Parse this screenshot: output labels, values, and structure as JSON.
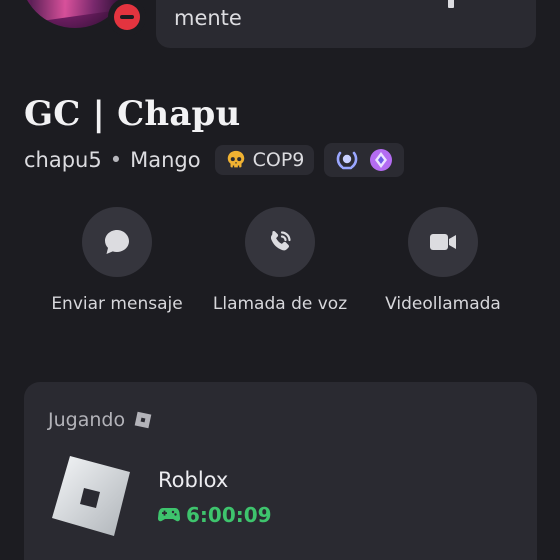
{
  "status_bubble": {
    "text": "mente"
  },
  "profile": {
    "display_name": "GC | Chapu",
    "username": "chapu5",
    "separator": "•",
    "pronouns": "Mango",
    "clan_tag": "COP9",
    "clan_icon": "skull-icon",
    "badge_icons": [
      "laurel-badge-icon",
      "nitro-gem-badge-icon"
    ]
  },
  "actions": [
    {
      "label": "Enviar mensaje",
      "icon": "chat-bubble-icon"
    },
    {
      "label": "Llamada de voz",
      "icon": "phone-call-icon"
    },
    {
      "label": "Videollamada",
      "icon": "video-camera-icon"
    }
  ],
  "activity": {
    "header": "Jugando",
    "game_name": "Roblox",
    "elapsed": "6:00:09",
    "game_icon": "roblox-logo",
    "controller_icon": "gamepad-icon"
  },
  "colors": {
    "background": "#1c1c21",
    "card": "#2a2a31",
    "button": "#35353d",
    "status_dnd": "#e3343f",
    "elapsed_green": "#3ec46d"
  }
}
